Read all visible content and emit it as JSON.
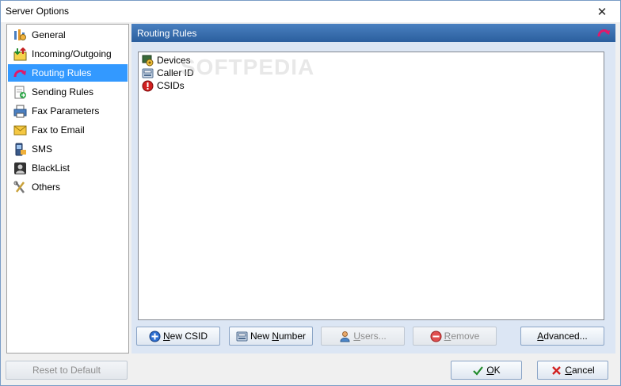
{
  "window": {
    "title": "Server Options",
    "close_glyph": "✕"
  },
  "sidebar": {
    "items": [
      {
        "label": "General",
        "icon": "general-icon",
        "selected": false
      },
      {
        "label": "Incoming/Outgoing",
        "icon": "incoming-outgoing-icon",
        "selected": false
      },
      {
        "label": "Routing Rules",
        "icon": "routing-rules-icon",
        "selected": true
      },
      {
        "label": "Sending Rules",
        "icon": "sending-rules-icon",
        "selected": false
      },
      {
        "label": "Fax Parameters",
        "icon": "fax-parameters-icon",
        "selected": false
      },
      {
        "label": "Fax to Email",
        "icon": "fax-to-email-icon",
        "selected": false
      },
      {
        "label": "SMS",
        "icon": "sms-icon",
        "selected": false
      },
      {
        "label": "BlackList",
        "icon": "blacklist-icon",
        "selected": false
      },
      {
        "label": "Others",
        "icon": "others-icon",
        "selected": false
      }
    ]
  },
  "panel": {
    "title": "Routing Rules",
    "tree": [
      {
        "label": "Devices",
        "icon": "devices-icon"
      },
      {
        "label": "Caller ID",
        "icon": "caller-id-icon"
      },
      {
        "label": "CSIDs",
        "icon": "csids-icon"
      }
    ],
    "watermark": "SOFTPEDIA"
  },
  "buttons": {
    "new_csid": {
      "pre": "",
      "ul": "N",
      "post": "ew CSID"
    },
    "new_number": {
      "pre": "New ",
      "ul": "N",
      "post": "umber"
    },
    "users": {
      "pre": "",
      "ul": "U",
      "post": "sers..."
    },
    "remove": {
      "pre": "",
      "ul": "R",
      "post": "emove"
    },
    "advanced": {
      "pre": "",
      "ul": "A",
      "post": "dvanced..."
    },
    "reset": {
      "label": "Reset to Default"
    },
    "ok": {
      "pre": "",
      "ul": "O",
      "post": "K"
    },
    "cancel": {
      "pre": "",
      "ul": "C",
      "post": "ancel"
    }
  },
  "colors": {
    "selection": "#3399ff",
    "header": "#2b5f9e",
    "content_bg": "#dce6f4"
  }
}
